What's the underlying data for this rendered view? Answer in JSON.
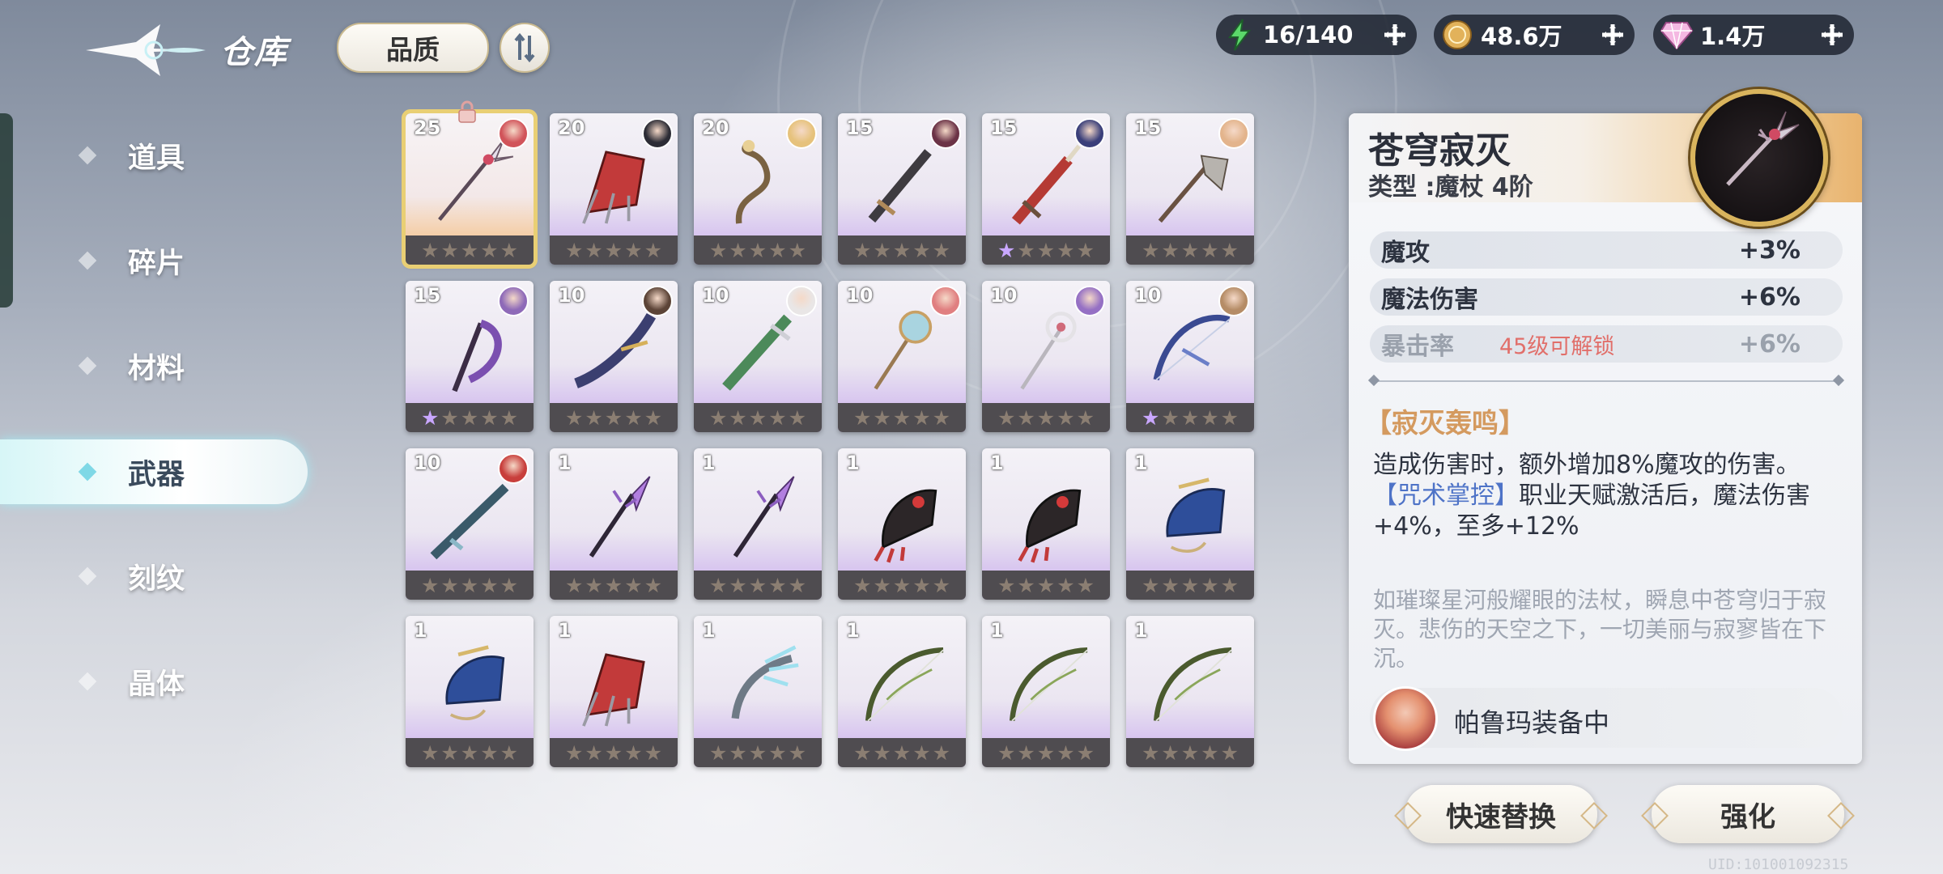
{
  "header": {
    "title": "仓库",
    "filter_label": "品质"
  },
  "resources": [
    {
      "name": "stamina",
      "icon": "lightning-icon",
      "value": "16/140"
    },
    {
      "name": "gold",
      "icon": "gold-coin-icon",
      "value": "48.6万"
    },
    {
      "name": "crystal",
      "icon": "diamond-icon",
      "value": "1.4万"
    }
  ],
  "sidebar": {
    "items": [
      {
        "label": "道具"
      },
      {
        "label": "碎片"
      },
      {
        "label": "材料"
      },
      {
        "label": "武器",
        "active": true
      },
      {
        "label": "刻纹"
      },
      {
        "label": "晶体"
      }
    ]
  },
  "grid": {
    "items": [
      {
        "level": "25",
        "weapon": "staff",
        "owner_color": "#d1545a",
        "stars_lit": 0,
        "selected": true,
        "locked": true
      },
      {
        "level": "20",
        "weapon": "red-gauntlet",
        "owner_color": "#2c2c35",
        "stars_lit": 0
      },
      {
        "level": "20",
        "weapon": "serpent-staff",
        "owner_color": "#e6c27c",
        "stars_lit": 0
      },
      {
        "level": "15",
        "weapon": "sword",
        "owner_color": "#6b3346",
        "stars_lit": 0
      },
      {
        "level": "15",
        "weapon": "red-sword",
        "owner_color": "#3a3f7a",
        "stars_lit": 1
      },
      {
        "level": "15",
        "weapon": "axe",
        "owner_color": "#e3b48c",
        "stars_lit": 0
      },
      {
        "level": "15",
        "weapon": "scythe",
        "owner_color": "#8e6ab8",
        "stars_lit": 1
      },
      {
        "level": "10",
        "weapon": "curved-blade",
        "owner_color": "#5c4437",
        "stars_lit": 0
      },
      {
        "level": "10",
        "weapon": "green-sword",
        "owner_color": "#e9e6e6",
        "stars_lit": 0
      },
      {
        "level": "10",
        "weapon": "mace-staff",
        "owner_color": "#e07f80",
        "stars_lit": 0
      },
      {
        "level": "10",
        "weapon": "silver-staff",
        "owner_color": "#9570c4",
        "stars_lit": 0
      },
      {
        "level": "10",
        "weapon": "bow-blue",
        "owner_color": "#b58c66",
        "stars_lit": 1
      },
      {
        "level": "10",
        "weapon": "rifle",
        "owner_color": "#c83f3c",
        "stars_lit": 0
      },
      {
        "level": "1",
        "weapon": "purple-blade",
        "owner_color": "",
        "stars_lit": 0
      },
      {
        "level": "1",
        "weapon": "purple-blade",
        "owner_color": "",
        "stars_lit": 0
      },
      {
        "level": "1",
        "weapon": "claw-gauntlet",
        "owner_color": "",
        "stars_lit": 0
      },
      {
        "level": "1",
        "weapon": "claw-gauntlet",
        "owner_color": "",
        "stars_lit": 0
      },
      {
        "level": "1",
        "weapon": "blue-gauntlet",
        "owner_color": "",
        "stars_lit": 0
      },
      {
        "level": "1",
        "weapon": "blue-gauntlet",
        "owner_color": "",
        "stars_lit": 0
      },
      {
        "level": "1",
        "weapon": "red-gauntlet",
        "owner_color": "",
        "stars_lit": 0
      },
      {
        "level": "1",
        "weapon": "ice-claw",
        "owner_color": "",
        "stars_lit": 0
      },
      {
        "level": "1",
        "weapon": "bow-green",
        "owner_color": "",
        "stars_lit": 0
      },
      {
        "level": "1",
        "weapon": "bow-green",
        "owner_color": "",
        "stars_lit": 0
      },
      {
        "level": "1",
        "weapon": "bow-green",
        "owner_color": "",
        "stars_lit": 0
      }
    ]
  },
  "detail": {
    "name": "苍穹寂灭",
    "type": "类型 :魔杖  4阶",
    "stats": [
      {
        "key": "魔攻",
        "value": "+3%"
      },
      {
        "key": "魔法伤害",
        "value": "+6%"
      },
      {
        "key": "暴击率",
        "value": "+6%",
        "locked": true,
        "note": "45级可解锁"
      }
    ],
    "skill_name": "【寂灭轰鸣】",
    "desc_line1": "造成伤害时，额外增加8%魔攻的伤害。",
    "desc_tag": "【咒术掌控】",
    "desc_line2": "职业天赋激活后，魔法伤害+4%，至多+12%",
    "lore": "如璀璨星河般耀眼的法杖，瞬息中苍穹归于寂灭。悲伤的天空之下，一切美丽与寂寥皆在下沉。",
    "equipped_by": "帕鲁玛装备中"
  },
  "actions": {
    "quick_replace": "快速替换",
    "enhance": "强化"
  },
  "uid": "UID:101001092315",
  "colors": {
    "accent_gold": "#e9cf74",
    "highlight_cyan": "#d7f6f7",
    "locked_red": "#e16f6a",
    "skill_orange": "#d49a5f",
    "tag_blue": "#4e73c7"
  }
}
